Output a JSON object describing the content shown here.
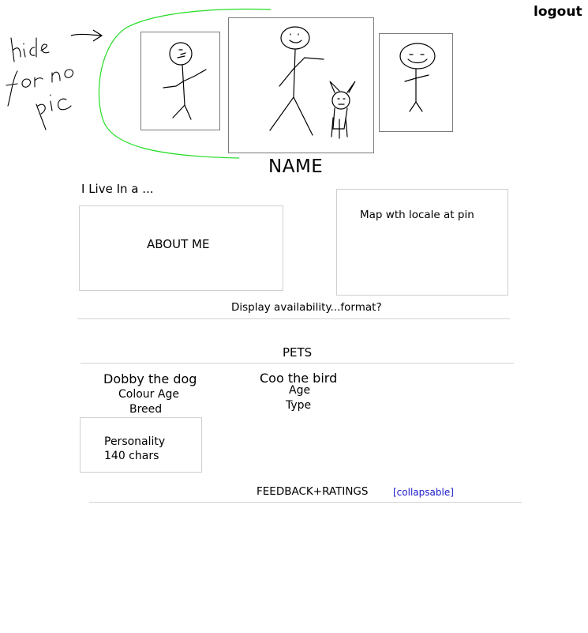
{
  "header": {
    "logout_label": "logout"
  },
  "annotation": {
    "handwritten_note": "hide for no pic",
    "arrow_color": "#000000",
    "bracket_color": "#22dd22"
  },
  "profile": {
    "name": "NAME",
    "live_in": "I Live In a ...",
    "about_label": "ABOUT ME",
    "map_label": "Map wth locale at pin",
    "availability": "Display availability...format?"
  },
  "pets": {
    "heading": "PETS",
    "items": [
      {
        "name": "Dobby the dog",
        "line1": "Colour Age",
        "line2": "Breed"
      },
      {
        "name": "Coo the bird",
        "line1": "Age",
        "line2": "Type"
      }
    ],
    "personality": {
      "line1": "Personality",
      "line2": "140 chars"
    }
  },
  "feedback": {
    "heading": "FEEDBACK+RATINGS",
    "collapsable_label": "[collapsable]"
  },
  "colors": {
    "border": "#7a7a7a",
    "box_border": "#cfcfcf",
    "divider": "#d3d3d3",
    "link": "#1a1acc"
  }
}
